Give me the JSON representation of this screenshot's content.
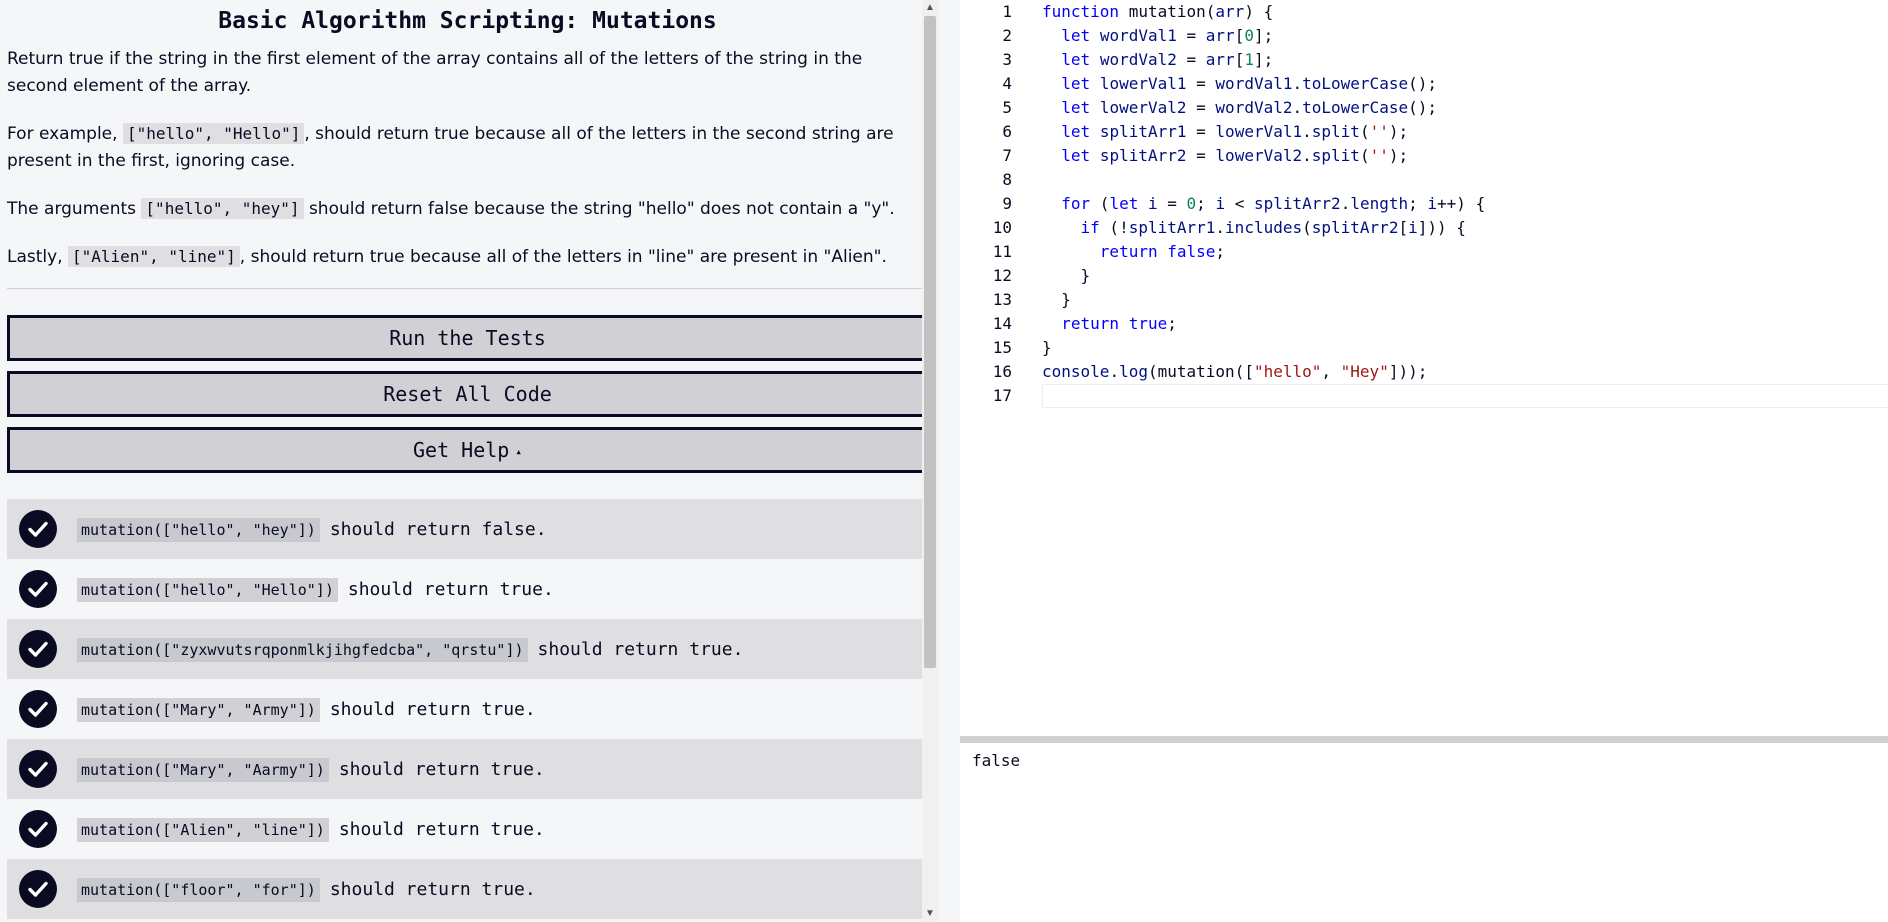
{
  "challenge": {
    "title": "Basic Algorithm Scripting: Mutations",
    "paragraphs": [
      {
        "before": "Return true if the string in the first element of the array contains all of the letters of the string in the second element of the array.",
        "code": "",
        "after": ""
      },
      {
        "before": "For example, ",
        "code": "[\"hello\", \"Hello\"]",
        "after": ", should return true because all of the letters in the second string are present in the first, ignoring case."
      },
      {
        "before": "The arguments ",
        "code": "[\"hello\", \"hey\"]",
        "after": " should return false because the string \"hello\" does not contain a \"y\"."
      },
      {
        "before": "Lastly, ",
        "code": "[\"Alien\", \"line\"]",
        "after": ", should return true because all of the letters in \"line\" are present in \"Alien\"."
      }
    ]
  },
  "buttons": {
    "run": "Run the Tests",
    "reset": "Reset All Code",
    "help": "Get Help",
    "help_caret": "▴"
  },
  "tests": [
    {
      "code": "mutation([\"hello\", \"hey\"])",
      "text": "should return false."
    },
    {
      "code": "mutation([\"hello\", \"Hello\"])",
      "text": "should return true."
    },
    {
      "code": "mutation([\"zyxwvutsrqponmlkjihgfedcba\", \"qrstu\"])",
      "text": "should return true."
    },
    {
      "code": "mutation([\"Mary\", \"Army\"])",
      "text": "should return true."
    },
    {
      "code": "mutation([\"Mary\", \"Aarmy\"])",
      "text": "should return true."
    },
    {
      "code": "mutation([\"Alien\", \"line\"])",
      "text": "should return true."
    },
    {
      "code": "mutation([\"floor\", \"for\"])",
      "text": "should return true."
    }
  ],
  "editor": {
    "lines": [
      [
        [
          "kw",
          "function"
        ],
        [
          "op",
          " "
        ],
        [
          "fn",
          "mutation"
        ],
        [
          "op",
          "("
        ],
        [
          "var",
          "arr"
        ],
        [
          "op",
          ") {"
        ]
      ],
      [
        [
          "op",
          "  "
        ],
        [
          "kw",
          "let"
        ],
        [
          "op",
          " "
        ],
        [
          "var",
          "wordVal1"
        ],
        [
          "op",
          " = "
        ],
        [
          "var",
          "arr"
        ],
        [
          "op",
          "["
        ],
        [
          "num",
          "0"
        ],
        [
          "op",
          "];"
        ]
      ],
      [
        [
          "op",
          "  "
        ],
        [
          "kw",
          "let"
        ],
        [
          "op",
          " "
        ],
        [
          "var",
          "wordVal2"
        ],
        [
          "op",
          " = "
        ],
        [
          "var",
          "arr"
        ],
        [
          "op",
          "["
        ],
        [
          "num",
          "1"
        ],
        [
          "op",
          "];"
        ]
      ],
      [
        [
          "op",
          "  "
        ],
        [
          "kw",
          "let"
        ],
        [
          "op",
          " "
        ],
        [
          "var",
          "lowerVal1"
        ],
        [
          "op",
          " = "
        ],
        [
          "var",
          "wordVal1"
        ],
        [
          "op",
          "."
        ],
        [
          "var",
          "toLowerCase"
        ],
        [
          "op",
          "();"
        ]
      ],
      [
        [
          "op",
          "  "
        ],
        [
          "kw",
          "let"
        ],
        [
          "op",
          " "
        ],
        [
          "var",
          "lowerVal2"
        ],
        [
          "op",
          " = "
        ],
        [
          "var",
          "wordVal2"
        ],
        [
          "op",
          "."
        ],
        [
          "var",
          "toLowerCase"
        ],
        [
          "op",
          "();"
        ]
      ],
      [
        [
          "op",
          "  "
        ],
        [
          "kw",
          "let"
        ],
        [
          "op",
          " "
        ],
        [
          "var",
          "splitArr1"
        ],
        [
          "op",
          " = "
        ],
        [
          "var",
          "lowerVal1"
        ],
        [
          "op",
          "."
        ],
        [
          "var",
          "split"
        ],
        [
          "op",
          "("
        ],
        [
          "str",
          "''"
        ],
        [
          "op",
          ");"
        ]
      ],
      [
        [
          "op",
          "  "
        ],
        [
          "kw",
          "let"
        ],
        [
          "op",
          " "
        ],
        [
          "var",
          "splitArr2"
        ],
        [
          "op",
          " = "
        ],
        [
          "var",
          "lowerVal2"
        ],
        [
          "op",
          "."
        ],
        [
          "var",
          "split"
        ],
        [
          "op",
          "("
        ],
        [
          "str",
          "''"
        ],
        [
          "op",
          ");"
        ]
      ],
      [
        [
          "op",
          ""
        ]
      ],
      [
        [
          "op",
          "  "
        ],
        [
          "kw",
          "for"
        ],
        [
          "op",
          " ("
        ],
        [
          "kw",
          "let"
        ],
        [
          "op",
          " "
        ],
        [
          "var",
          "i"
        ],
        [
          "op",
          " = "
        ],
        [
          "num",
          "0"
        ],
        [
          "op",
          "; "
        ],
        [
          "var",
          "i"
        ],
        [
          "op",
          " < "
        ],
        [
          "var",
          "splitArr2"
        ],
        [
          "op",
          "."
        ],
        [
          "var",
          "length"
        ],
        [
          "op",
          "; "
        ],
        [
          "var",
          "i"
        ],
        [
          "op",
          "++) {"
        ]
      ],
      [
        [
          "op",
          "    "
        ],
        [
          "kw",
          "if"
        ],
        [
          "op",
          " (!"
        ],
        [
          "var",
          "splitArr1"
        ],
        [
          "op",
          "."
        ],
        [
          "var",
          "includes"
        ],
        [
          "op",
          "("
        ],
        [
          "var",
          "splitArr2"
        ],
        [
          "op",
          "["
        ],
        [
          "var",
          "i"
        ],
        [
          "op",
          "])) {"
        ]
      ],
      [
        [
          "op",
          "      "
        ],
        [
          "kw",
          "return"
        ],
        [
          "op",
          " "
        ],
        [
          "kw",
          "false"
        ],
        [
          "op",
          ";"
        ]
      ],
      [
        [
          "op",
          "    }"
        ]
      ],
      [
        [
          "op",
          "  }"
        ]
      ],
      [
        [
          "op",
          "  "
        ],
        [
          "kw",
          "return"
        ],
        [
          "op",
          " "
        ],
        [
          "kw",
          "true"
        ],
        [
          "op",
          ";"
        ]
      ],
      [
        [
          "op",
          "}"
        ]
      ],
      [
        [
          "var",
          "console"
        ],
        [
          "op",
          "."
        ],
        [
          "var",
          "log"
        ],
        [
          "op",
          "("
        ],
        [
          "fn",
          "mutation"
        ],
        [
          "op",
          "(["
        ],
        [
          "str",
          "\"hello\""
        ],
        [
          "op",
          ", "
        ],
        [
          "str",
          "\"Hey\""
        ],
        [
          "op",
          "]));"
        ]
      ],
      [
        [
          "op",
          ""
        ]
      ]
    ]
  },
  "console": {
    "output": "false"
  }
}
